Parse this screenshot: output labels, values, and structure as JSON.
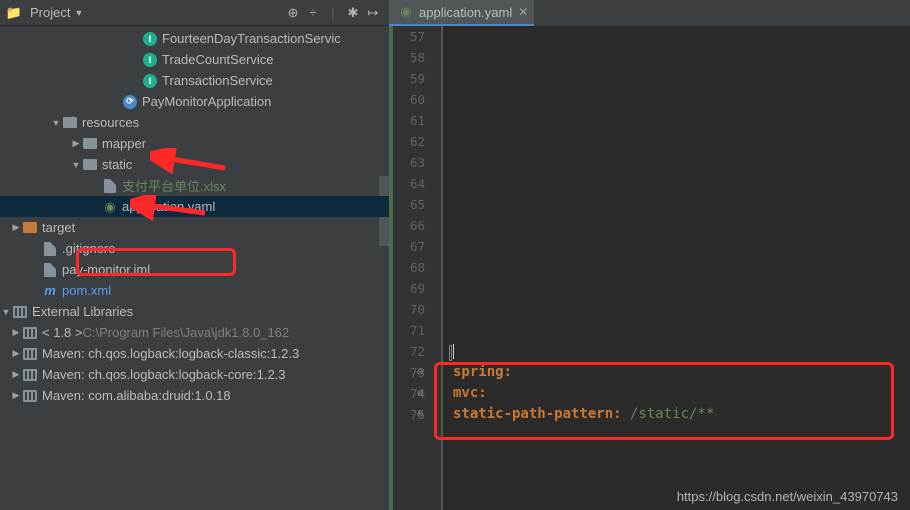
{
  "toolbar": {
    "title": "Project"
  },
  "tree": {
    "items": [
      {
        "indent": 120,
        "icon": "interface-icon",
        "label": "FourteenDayTransactionServic"
      },
      {
        "indent": 120,
        "icon": "interface-icon",
        "label": "TradeCountService"
      },
      {
        "indent": 120,
        "icon": "interface-icon",
        "label": "TransactionService"
      },
      {
        "indent": 100,
        "icon": "class-icon",
        "label": "PayMonitorApplication"
      },
      {
        "indent": 40,
        "chev": "▼",
        "icon": "resources-folder-icon",
        "label": "resources"
      },
      {
        "indent": 60,
        "chev": "▶",
        "icon": "folder-icon",
        "label": "mapper"
      },
      {
        "indent": 60,
        "chev": "▼",
        "icon": "folder-icon",
        "label": "static"
      },
      {
        "indent": 80,
        "icon": "file-icon",
        "label": "支付平台单位.xlsx",
        "cls": "green"
      },
      {
        "indent": 80,
        "icon": "yaml-icon",
        "label": "application.yaml",
        "selected": true
      },
      {
        "indent": 0,
        "chev": "▶",
        "icon": "target-folder-icon",
        "label": "target"
      },
      {
        "indent": 20,
        "icon": "file-icon",
        "label": ".gitignore"
      },
      {
        "indent": 20,
        "icon": "file-icon",
        "label": "pay-monitor.iml"
      },
      {
        "indent": 20,
        "icon": "maven-icon",
        "label": "pom.xml",
        "cls": "blue"
      }
    ],
    "ext_libs": "External Libraries",
    "libs": [
      {
        "label": "< 1.8 >",
        "tail": "C:\\Program Files\\Java\\jdk1.8.0_162"
      },
      {
        "label": "Maven: ch.qos.logback:logback-classic:1.2.3"
      },
      {
        "label": "Maven: ch.qos.logback:logback-core:1.2.3"
      },
      {
        "label": "Maven: com.alibaba:druid:1.0.18"
      }
    ]
  },
  "tab": {
    "name": "application.yaml"
  },
  "gutter": {
    "start": 57,
    "end": 75
  },
  "code": {
    "l73": "spring:",
    "l74_k": "mvc:",
    "l75_k": "static-path-pattern:",
    "l75_v": " /static/**"
  },
  "watermark": "https://blog.csdn.net/weixin_43970743"
}
